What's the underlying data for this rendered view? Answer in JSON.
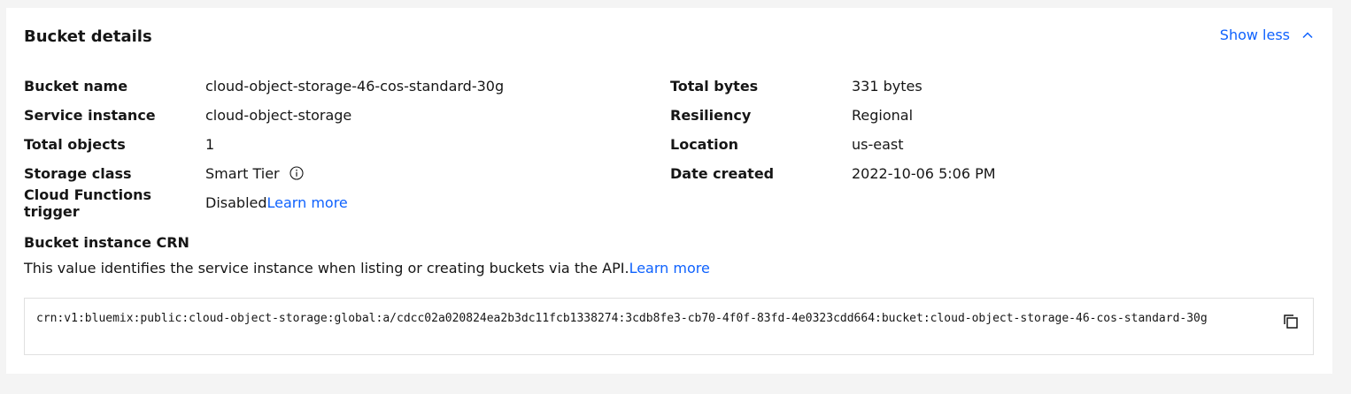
{
  "header": {
    "title": "Bucket details",
    "toggle_label": "Show less"
  },
  "details_left": [
    {
      "label": "Bucket name",
      "value": "cloud-object-storage-46-cos-standard-30g"
    },
    {
      "label": "Service instance",
      "value": "cloud-object-storage"
    },
    {
      "label": "Total objects",
      "value": "1"
    },
    {
      "label": "Storage class",
      "value": "Smart Tier"
    },
    {
      "label": "Cloud Functions trigger",
      "value": "Disabled",
      "link": "Learn more"
    }
  ],
  "details_right": [
    {
      "label": "Total bytes",
      "value": "331 bytes"
    },
    {
      "label": "Resiliency",
      "value": "Regional"
    },
    {
      "label": "Location",
      "value": "us-east"
    },
    {
      "label": "Date created",
      "value": "2022-10-06 5:06 PM"
    }
  ],
  "crn": {
    "title": "Bucket instance CRN",
    "description": "This value identifies the service instance when listing or creating buckets via the API.",
    "link": "Learn more",
    "value": "crn:v1:bluemix:public:cloud-object-storage:global:a/cdcc02a020824ea2b3dc11fcb1338274:3cdb8fe3-cb70-4f0f-83fd-4e0323cdd664:bucket:cloud-object-storage-46-cos-standard-30g"
  },
  "icons": {
    "toggle": "chevron-up-icon",
    "storage_class_info": "info-icon",
    "copy": "copy-icon"
  },
  "colors": {
    "link": "#0f62fe",
    "text": "#161616",
    "page_background": "#f4f4f4"
  }
}
